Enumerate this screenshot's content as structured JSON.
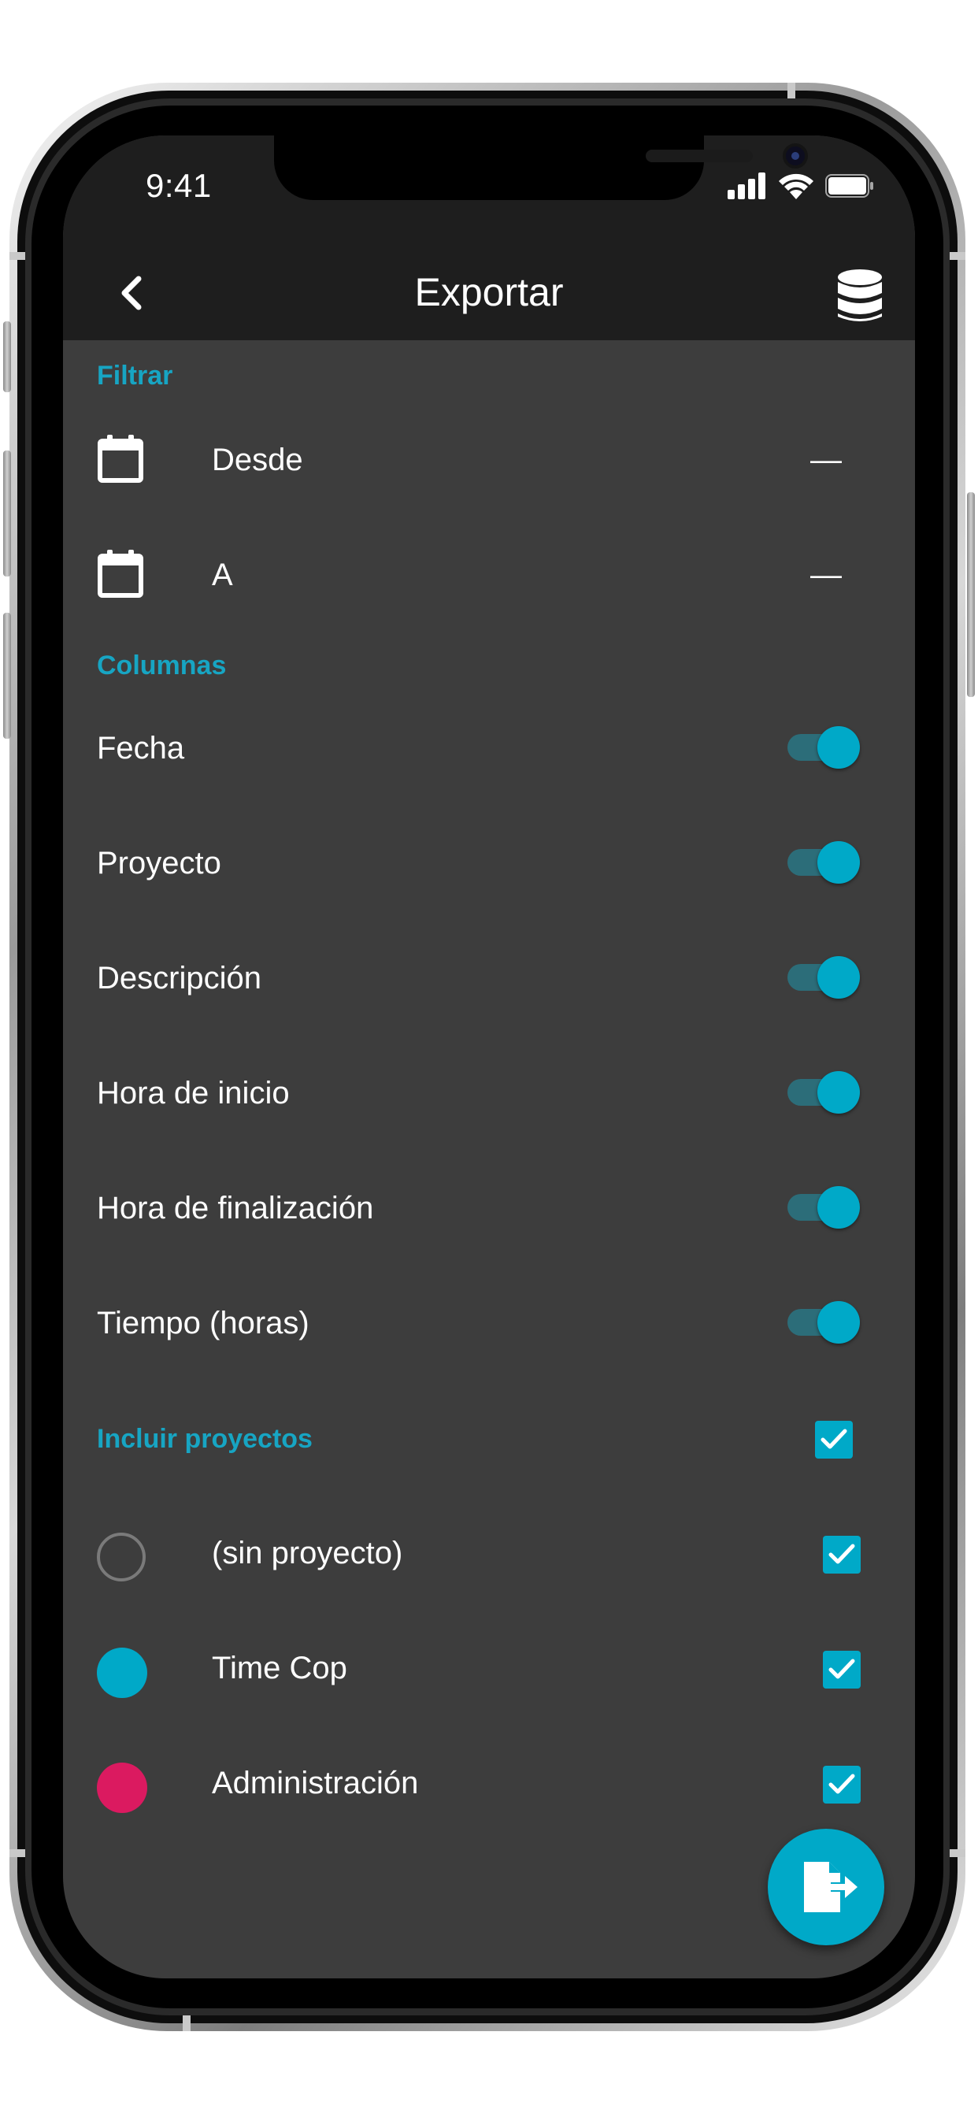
{
  "status_bar": {
    "time": "9:41"
  },
  "app_bar": {
    "title": "Exportar",
    "back_icon": "chevron-left-icon",
    "action_icon": "database-icon"
  },
  "filter": {
    "header": "Filtrar",
    "rows": [
      {
        "label": "Desde",
        "value": "—",
        "icon": "calendar-icon"
      },
      {
        "label": "A",
        "value": "—",
        "icon": "calendar-icon"
      }
    ]
  },
  "columns": {
    "header": "Columnas",
    "items": [
      {
        "label": "Fecha",
        "enabled": true
      },
      {
        "label": "Proyecto",
        "enabled": true
      },
      {
        "label": "Descripción",
        "enabled": true
      },
      {
        "label": "Hora de inicio",
        "enabled": true
      },
      {
        "label": "Hora de finalización",
        "enabled": true
      },
      {
        "label": "Tiempo (horas)",
        "enabled": true
      }
    ]
  },
  "projects": {
    "header": "Incluir proyectos",
    "all_checked": true,
    "items": [
      {
        "label": "(sin proyecto)",
        "color": "none",
        "checked": true
      },
      {
        "label": "Time Cop",
        "color": "#00a9c8",
        "checked": true
      },
      {
        "label": "Administración",
        "color": "#db1a60",
        "checked": true
      }
    ]
  },
  "fab": {
    "icon": "file-export-icon"
  },
  "colors": {
    "accent": "#00a9c8",
    "header_text": "#17a5c3",
    "background": "#3d3d3d",
    "app_bar": "#1e1e1e"
  }
}
